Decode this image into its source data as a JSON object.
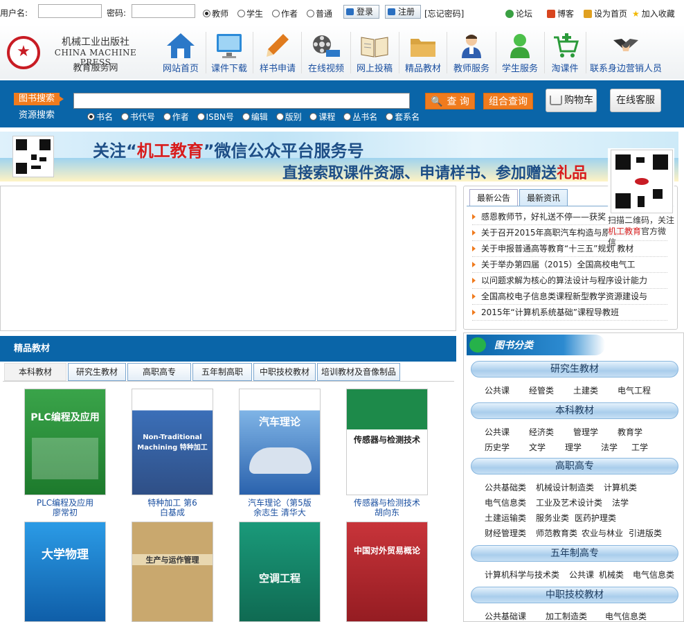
{
  "topbar": {
    "username_label": "用户名:",
    "password_label": "密码:",
    "roles": [
      {
        "label": "教师",
        "checked": true
      },
      {
        "label": "学生",
        "checked": false
      },
      {
        "label": "作者",
        "checked": false
      },
      {
        "label": "普通",
        "checked": false
      }
    ],
    "login_label": "登录",
    "register_label": "注册",
    "forgot_label": "[忘记密码]",
    "links": {
      "forum": "论坛",
      "blog": "博客",
      "homepage": "设为首页",
      "favorite": "加入收藏"
    }
  },
  "logo": {
    "cn": "机械工业出版社",
    "en": "CHINA MACHINE PRESS",
    "sub": "教育服务网"
  },
  "nav": [
    {
      "label": "网站首页",
      "icon": "home-icon"
    },
    {
      "label": "课件下载",
      "icon": "monitor-icon"
    },
    {
      "label": "样书申请",
      "icon": "pencil-icon"
    },
    {
      "label": "在线视频",
      "icon": "film-reel-icon"
    },
    {
      "label": "网上投稿",
      "icon": "open-book-icon"
    },
    {
      "label": "精品教材",
      "icon": "folder-icon"
    },
    {
      "label": "教师服务",
      "icon": "teacher-icon"
    },
    {
      "label": "学生服务",
      "icon": "student-icon"
    },
    {
      "label": "淘课件",
      "icon": "shopping-cart-icon"
    },
    {
      "label": "联系身边营销人员",
      "icon": "handshake-icon"
    }
  ],
  "search": {
    "book_search": "图书搜索",
    "resource_search": "资源搜索",
    "query_label": "查 询",
    "combo_label": "组合查询",
    "cart_label": "购物车",
    "service_label": "在线客服",
    "fields": [
      {
        "label": "书名",
        "checked": true
      },
      {
        "label": "书代号",
        "checked": false
      },
      {
        "label": "作者",
        "checked": false
      },
      {
        "label": "ISBN号",
        "checked": false
      },
      {
        "label": "编辑",
        "checked": false
      },
      {
        "label": "版别",
        "checked": false
      },
      {
        "label": "课程",
        "checked": false
      },
      {
        "label": "丛书名",
        "checked": false
      },
      {
        "label": "套系名",
        "checked": false
      }
    ]
  },
  "banner": {
    "line1_a": "关注“",
    "line1_hl": "机工教育",
    "line1_b": "”微信公众平台服务号",
    "line2_a": "直接索取课件资源、申请样书、参加赠送",
    "line2_hl": "礼品"
  },
  "float_qr": {
    "caption_a": "扫描二维码，关注",
    "caption_red": "机工教育",
    "caption_b": "官方微信"
  },
  "news": {
    "tabs": [
      "最新公告",
      "最新资讯"
    ],
    "items": [
      "感恩教师节，好礼送不停——获奖",
      "关于召开2015年高职汽车构造与原理课程",
      "关于申报普通高等教育“十三五”规划 教材",
      "关于举办第四届（2015）全国高校电气工",
      "以问题求解为核心的算法设计与程序设计能力",
      "全国高校电子信息类课程新型教学资源建设与",
      "2015年“计算机系统基础”课程导教班"
    ]
  },
  "textbooks": {
    "title": "精品教材",
    "tabs": [
      "本科教材",
      "研究生教材",
      "高职高专",
      "五年制高职",
      "中职技校教材",
      "培训教材及音像制品"
    ],
    "books": [
      {
        "title": "PLC编程及应用",
        "author": "廖常初",
        "cover_text": "PLC编程及应用",
        "color": "#2f8f3a"
      },
      {
        "title": "特种加工  第6",
        "author": "白基成",
        "cover_text": "Non-Traditional Machining 特种加工",
        "color": "#3b6fb8"
      },
      {
        "title": "汽车理论（第5版",
        "author": "余志生 清华大",
        "cover_text": "汽车理论",
        "color": "#2e6db6"
      },
      {
        "title": "传感器与检测技术",
        "author": "胡向东",
        "cover_text": "传感器与检测技术",
        "color": "#1d8a4a"
      },
      {
        "title": "",
        "author": "",
        "cover_text": "大学物理",
        "color": "#1a7fcf"
      },
      {
        "title": "",
        "author": "",
        "cover_text": "生产与运作管理",
        "color": "#c9a86e"
      },
      {
        "title": "",
        "author": "",
        "cover_text": "空调工程",
        "color": "#1a8a6a"
      },
      {
        "title": "",
        "author": "",
        "cover_text": "中国对外贸易概论",
        "color": "#b4272d"
      }
    ]
  },
  "categories": {
    "title": "图书分类",
    "groups": [
      {
        "name": "研究生教材",
        "rows": [
          [
            "公共课",
            "经管类",
            "土建类",
            "电气工程"
          ]
        ]
      },
      {
        "name": "本科教材",
        "rows": [
          [
            "公共课",
            "经济类",
            "管理学",
            "教育学"
          ],
          [
            "历史学",
            "文学",
            "理学",
            "法学",
            "工学"
          ]
        ]
      },
      {
        "name": "高职高专",
        "rows": [
          [
            "公共基础类",
            "机械设计制造类",
            "计算机类"
          ],
          [
            "电气信息类",
            "工业及艺术设计类",
            "法学"
          ],
          [
            "土建运输类",
            "服务业类",
            "医药护理类"
          ],
          [
            "财经管理类",
            "师范教育类",
            "农业与林业",
            "引进版类"
          ]
        ]
      },
      {
        "name": "五年制高专",
        "rows": [
          [
            "计算机科学与技术类",
            "公共课",
            "机械类",
            "电气信息类"
          ]
        ]
      },
      {
        "name": "中职技校教材",
        "rows": [
          [
            "公共基础课",
            "加工制造类",
            "电气信息类"
          ]
        ]
      }
    ]
  },
  "colors": {
    "brand_blue": "#0a65a8",
    "accent_orange": "#f07b1e",
    "logo_red": "#c81c24",
    "link_blue": "#1a4fa0"
  }
}
